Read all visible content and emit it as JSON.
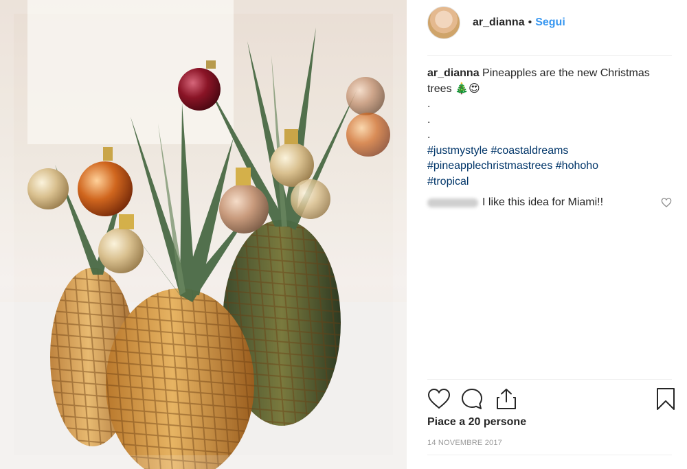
{
  "post": {
    "username": "ar_dianna",
    "separator": "•",
    "follow_label": "Segui",
    "caption": {
      "username": "ar_dianna",
      "text": "Pineapples are the new Christmas trees 🎄😍",
      "dots": [
        ".",
        ".",
        "."
      ],
      "hashtags": [
        "#justmystyle",
        "#coastaldreams",
        "#pineapplechristmastrees",
        "#hohoho",
        "#tropical"
      ]
    },
    "comment": {
      "text": "I like this idea for Miami!!"
    },
    "likes_text": "Piace a 20 persone",
    "date": "14 NOVEMBRE 2017"
  },
  "icons": {
    "like": "heart-icon",
    "comment": "speech-bubble-icon",
    "share": "share-icon",
    "save": "bookmark-icon",
    "comment_like": "small-heart-icon"
  },
  "colors": {
    "accent": "#3897f0",
    "hashtag": "#003569",
    "text": "#262626",
    "muted": "#999999",
    "divider": "#efefef"
  }
}
